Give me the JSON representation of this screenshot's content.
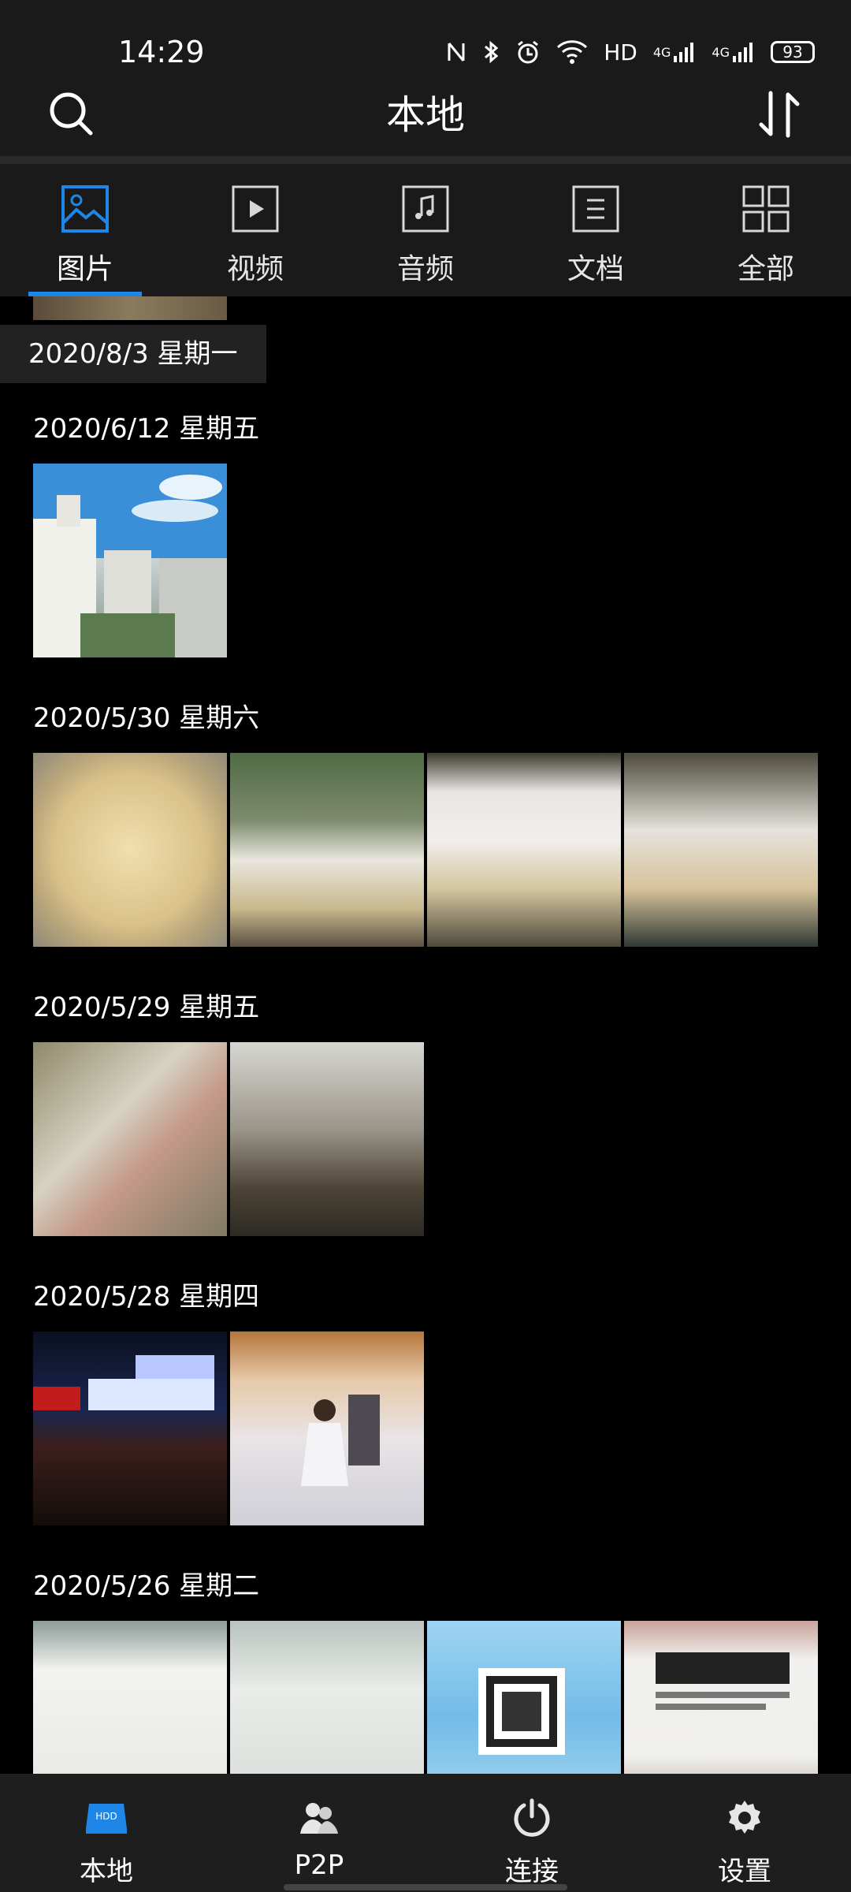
{
  "status_bar": {
    "time": "14:29",
    "network_hd": "HD",
    "signal1_label": "4G",
    "signal2_label": "4G",
    "battery": "93"
  },
  "header": {
    "title": "本地"
  },
  "tabs": [
    {
      "label": "图片",
      "icon": "image-icon",
      "active": true
    },
    {
      "label": "视频",
      "icon": "video-icon",
      "active": false
    },
    {
      "label": "音频",
      "icon": "music-icon",
      "active": false
    },
    {
      "label": "文档",
      "icon": "document-icon",
      "active": false
    },
    {
      "label": "全部",
      "icon": "grid-icon",
      "active": false
    }
  ],
  "sticky_date": "2020/8/3 星期一",
  "sections": [
    {
      "date": "2020/6/12 星期五",
      "count": 1
    },
    {
      "date": "2020/5/30 星期六",
      "count": 4
    },
    {
      "date": "2020/5/29 星期五",
      "count": 2
    },
    {
      "date": "2020/5/28 星期四",
      "count": 2
    },
    {
      "date": "2020/5/26 星期二",
      "count": 4
    }
  ],
  "bottom_nav": [
    {
      "label": "本地",
      "icon": "hdd-icon"
    },
    {
      "label": "P2P",
      "icon": "users-icon"
    },
    {
      "label": "连接",
      "icon": "power-icon"
    },
    {
      "label": "设置",
      "icon": "gear-icon"
    }
  ],
  "hdd_badge": "HDD",
  "colors": {
    "accent": "#1e86e6",
    "bar_bg": "#1a1a1a",
    "content_bg": "#000000"
  }
}
